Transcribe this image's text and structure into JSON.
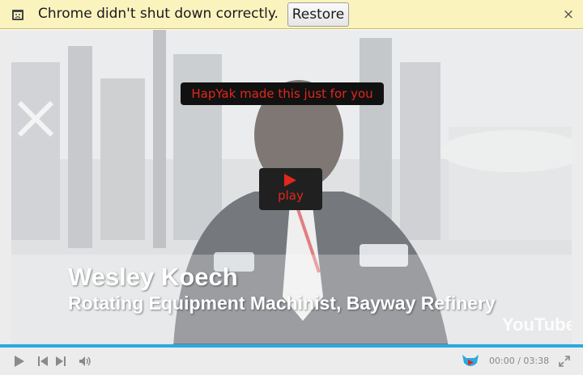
{
  "infobar": {
    "icon": "crashed-tab-icon",
    "message": "Chrome didn't shut down correctly.",
    "restore_label": "Restore",
    "close_glyph": "×"
  },
  "video": {
    "hapyak_banner": "HapYak made this just for you",
    "play_label": "play",
    "caption_name": "Wesley Koech",
    "caption_title": "Rotating Equipment Machinist, Bayway Refinery",
    "watermark": "YouTube"
  },
  "controls": {
    "current_time": "00:00",
    "separator": "/",
    "duration": "03:38",
    "accent_color": "#2aa9e0"
  },
  "colors": {
    "infobar_bg": "#fbf3be",
    "hapyak_red": "#e0281c"
  }
}
